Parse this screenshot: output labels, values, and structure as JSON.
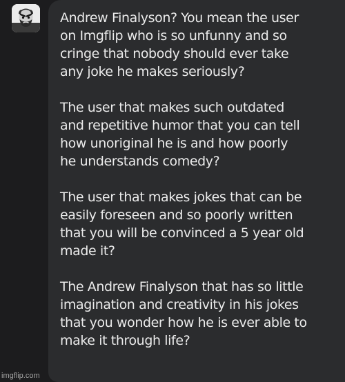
{
  "avatar": {
    "icon": "angry-man-avatar-icon"
  },
  "message": {
    "paragraphs": [
      {
        "lines": [
          "Andrew Finalyson? You mean the user",
          "on Imgflip who is so unfunny and so",
          "cringe that nobody should ever take",
          "any joke he makes seriously?"
        ]
      },
      {
        "lines": [
          "The user that makes such outdated",
          "and repetitive humor that you can tell",
          "how unoriginal he is and how poorly",
          "he understands comedy?"
        ]
      },
      {
        "lines": [
          "The user that makes jokes that can be",
          "easily foreseen and so poorly written",
          "that you will be convinced a 5 year old",
          "made it?"
        ]
      },
      {
        "lines": [
          "The Andrew Finalyson that has so little",
          "imagination and creativity in his jokes",
          "that you wonder how he is ever able to",
          "make it through life?"
        ]
      }
    ]
  },
  "watermark": "imgflip.com",
  "colors": {
    "background": "#1c1c1e",
    "bubble": "#2b2c2e",
    "text": "#ebebeb"
  }
}
